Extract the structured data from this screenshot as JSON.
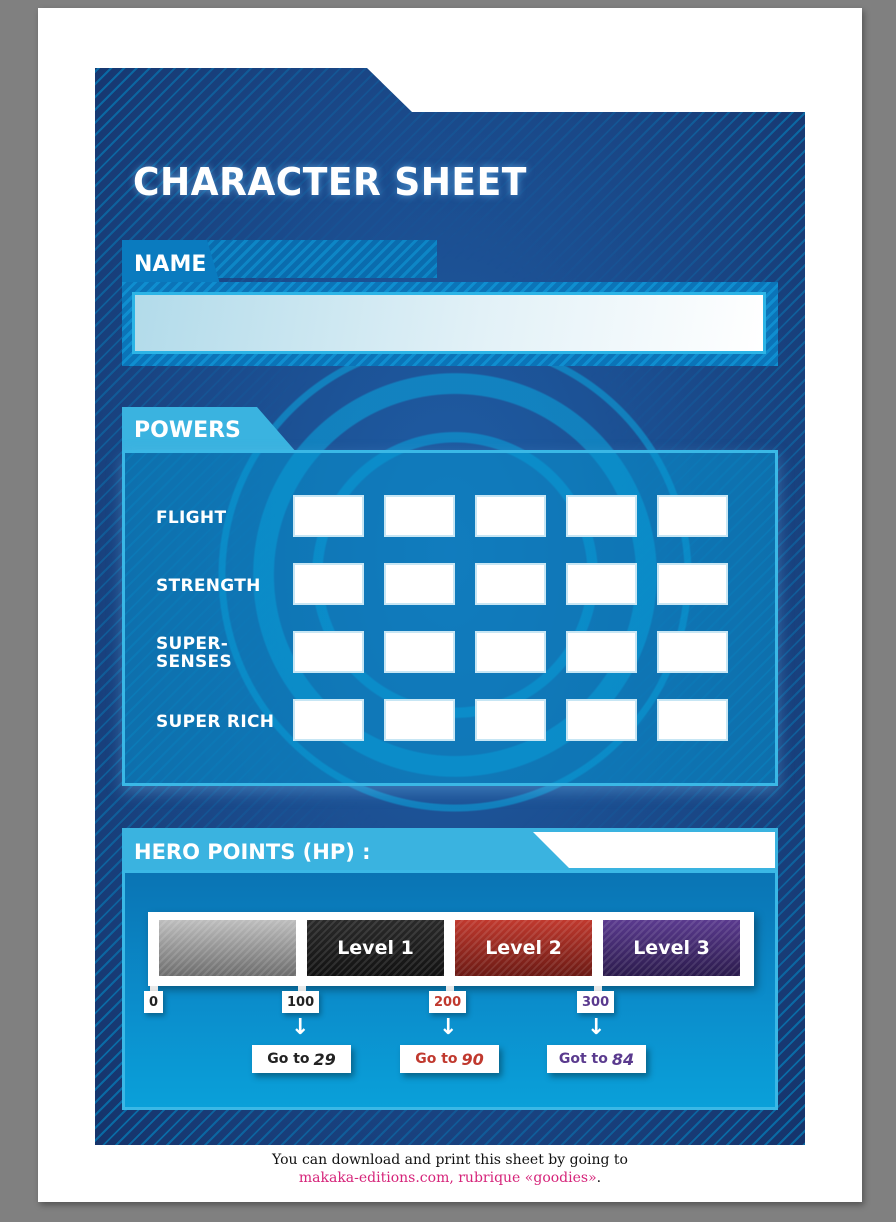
{
  "document": {
    "title": "CHARACTER SHEET",
    "colors": {
      "sheet_bg": "#1b4d8f",
      "panel_accent": "#3ab3e0",
      "level2": "#c0392e",
      "level3": "#5a3a8e",
      "link": "#d6247a"
    }
  },
  "name_section": {
    "label": "NAME",
    "value": "",
    "placeholder": ""
  },
  "powers": {
    "label": "POWERS",
    "rows": [
      {
        "label": "FLIGHT",
        "boxes": 5
      },
      {
        "label": "STRENGTH",
        "boxes": 5
      },
      {
        "label": "SUPER-\nSENSES",
        "label_line1": "SUPER-",
        "label_line2": "SENSES",
        "boxes": 5
      },
      {
        "label": "SUPER RICH",
        "boxes": 5
      }
    ]
  },
  "hero_points": {
    "label": "HERO POINTS (HP) :",
    "value": "",
    "levels": [
      {
        "label": ""
      },
      {
        "label": "Level 1"
      },
      {
        "label": "Level 2"
      },
      {
        "label": "Level 3"
      }
    ],
    "thresholds": [
      {
        "value": "0",
        "color": "#222222"
      },
      {
        "value": "100",
        "color": "#222222"
      },
      {
        "value": "200",
        "color": "#c0392e"
      },
      {
        "value": "300",
        "color": "#5a3a8e"
      }
    ],
    "arrow_icon": "↓",
    "goto": [
      {
        "text": "Go to",
        "page": "29",
        "color": "#222222"
      },
      {
        "text": "Go to",
        "page": "90",
        "color": "#c0392e"
      },
      {
        "text": "Got to",
        "page": "84",
        "color": "#5a3a8e"
      }
    ]
  },
  "footer": {
    "line1": "You can download and print this sheet by going to",
    "link": "makaka-editions.com, rubrique «goodies»",
    "period": "."
  }
}
